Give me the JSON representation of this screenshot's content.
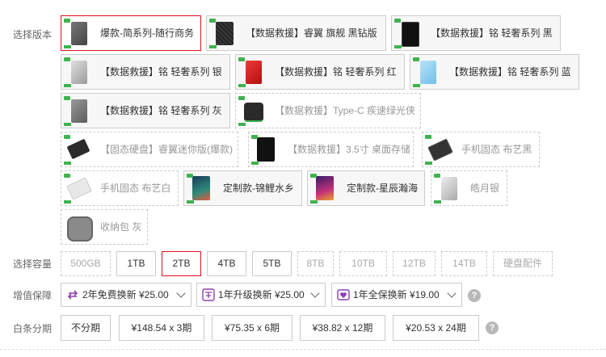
{
  "labels": {
    "version": "选择版本",
    "capacity": "选择容量",
    "service": "增值保障",
    "installment": "白条分期"
  },
  "variants": [
    {
      "label": "爆款-简系列-随行商务",
      "state": "selected"
    },
    {
      "label": "【数据救援】睿翼 旗舰 黑钻版",
      "state": "normal"
    },
    {
      "label": "【数据救援】铭 轻奢系列 黑",
      "state": "normal"
    },
    {
      "label": "【数据救援】铭 轻奢系列 银",
      "state": "normal"
    },
    {
      "label": "【数据救援】铭 轻奢系列 红",
      "state": "normal"
    },
    {
      "label": "【数据救援】铭 轻奢系列 蓝",
      "state": "normal"
    },
    {
      "label": "【数据救援】铭 轻奢系列 灰",
      "state": "normal"
    },
    {
      "label": "【数据救援】Type-C 疾速绿光侠",
      "state": "disabled"
    },
    {
      "label": "【固态硬盘】睿翼迷你版(爆款)",
      "state": "disabled"
    },
    {
      "label": "【数据救援】3.5寸 桌面存储",
      "state": "disabled"
    },
    {
      "label": "手机固态 布艺黑",
      "state": "disabled"
    },
    {
      "label": "手机固态 布艺白",
      "state": "disabled"
    },
    {
      "label": "定制款-锦鲤水乡",
      "state": "normal"
    },
    {
      "label": "定制款-星辰瀚海",
      "state": "normal"
    },
    {
      "label": "皓月银",
      "state": "disabled"
    },
    {
      "label": "收纳包 灰",
      "state": "disabled"
    }
  ],
  "capacities": [
    {
      "label": "500GB",
      "state": "disabled"
    },
    {
      "label": "1TB",
      "state": "normal"
    },
    {
      "label": "2TB",
      "state": "selected"
    },
    {
      "label": "4TB",
      "state": "normal"
    },
    {
      "label": "5TB",
      "state": "normal"
    },
    {
      "label": "8TB",
      "state": "disabled"
    },
    {
      "label": "10TB",
      "state": "disabled"
    },
    {
      "label": "12TB",
      "state": "disabled"
    },
    {
      "label": "14TB",
      "state": "disabled"
    },
    {
      "label": "硬盘配件",
      "state": "disabled"
    }
  ],
  "services": [
    {
      "label": "2年免费换新 ¥25.00",
      "icon": "swap-icon"
    },
    {
      "label": "1年升级换新 ¥25.00",
      "icon": "upgrade-icon"
    },
    {
      "label": "1年全保换新 ¥19.00",
      "icon": "shield-heart-icon"
    }
  ],
  "installments": [
    {
      "label": "不分期"
    },
    {
      "label": "¥148.54 x 3期"
    },
    {
      "label": "¥75.35 x 6期"
    },
    {
      "label": "¥38.82 x 12期"
    },
    {
      "label": "¥20.53 x 24期"
    }
  ],
  "help_glyph": "?",
  "colors": {
    "selected_border": "#e3101e",
    "accent_purple": "#8e3fb0",
    "tag_green": "#3fb34f"
  }
}
